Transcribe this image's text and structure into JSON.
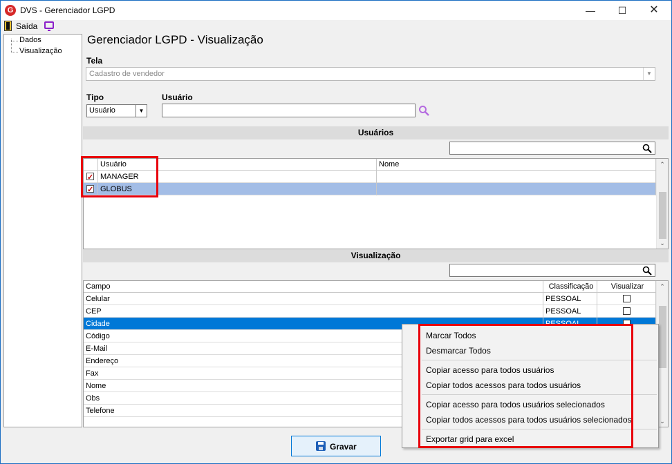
{
  "window": {
    "title": "DVS - Gerenciador LGPD",
    "icon": "app-logo-icon",
    "controls": [
      "minimize",
      "maximize",
      "close"
    ]
  },
  "menu": {
    "saida_label": "Saída"
  },
  "tree": {
    "items": [
      {
        "label": "Dados"
      },
      {
        "label": "Visualização"
      }
    ]
  },
  "page_title": "Gerenciador LGPD - Visualização",
  "tela": {
    "label": "Tela",
    "value": "Cadastro de vendedor"
  },
  "tipo": {
    "label": "Tipo",
    "value": "Usuário"
  },
  "usuario": {
    "label": "Usuário",
    "value": ""
  },
  "usuarios_section": {
    "title": "Usuários",
    "columns": [
      "Usuário",
      "Nome"
    ],
    "rows": [
      {
        "checked": true,
        "usuario": "MANAGER",
        "nome": "",
        "selected": false
      },
      {
        "checked": true,
        "usuario": "GLOBUS",
        "nome": "",
        "selected": true
      }
    ]
  },
  "visualizacao_section": {
    "title": "Visualização",
    "columns": [
      "Campo",
      "Classificação",
      "Visualizar"
    ],
    "rows": [
      {
        "campo": "Celular",
        "classificacao": "PESSOAL",
        "visualizar": false
      },
      {
        "campo": "CEP",
        "classificacao": "PESSOAL",
        "visualizar": false
      },
      {
        "campo": "Cidade",
        "classificacao": "PESSOAL",
        "visualizar": false,
        "selected": true
      },
      {
        "campo": "Código",
        "classificacao": "",
        "visualizar": false
      },
      {
        "campo": "E-Mail",
        "classificacao": "",
        "visualizar": false
      },
      {
        "campo": "Endereço",
        "classificacao": "",
        "visualizar": false
      },
      {
        "campo": "Fax",
        "classificacao": "",
        "visualizar": false
      },
      {
        "campo": "Nome",
        "classificacao": "",
        "visualizar": false
      },
      {
        "campo": "Obs",
        "classificacao": "",
        "visualizar": false
      },
      {
        "campo": "Telefone",
        "classificacao": "",
        "visualizar": false
      }
    ]
  },
  "context_menu": {
    "items": [
      "Marcar Todos",
      "Desmarcar Todos",
      "Copiar acesso para todos usuários",
      "Copiar todos acessos para todos usuários",
      "Copiar acesso para todos usuários selecionados",
      "Copiar todos acessos para todos usuários selecionados",
      "Exportar grid para excel"
    ]
  },
  "footer": {
    "gravar_label": "Gravar"
  },
  "colors": {
    "selected_row_light": "#a3bde6",
    "selected_row_dark": "#0078d7",
    "highlight_border": "#e8000c",
    "window_border": "#1b6ec2"
  }
}
